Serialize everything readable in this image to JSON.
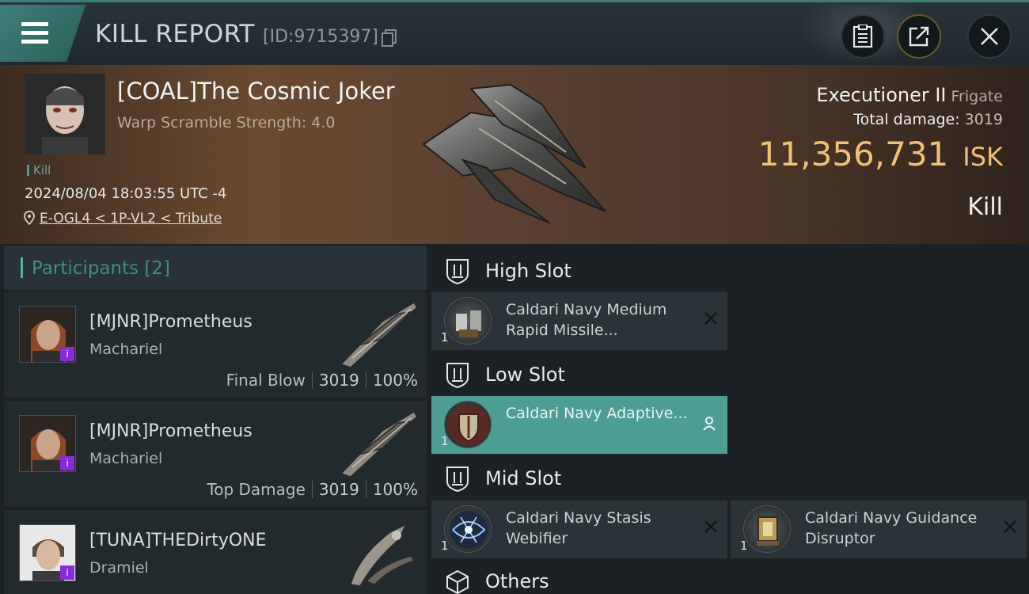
{
  "header": {
    "title": "KILL REPORT",
    "id_label": "[ID:9715397]",
    "icons": [
      "menu-icon",
      "copy-icon",
      "clipboard-icon",
      "share-icon",
      "close-icon"
    ]
  },
  "victim": {
    "name": "[COAL]The Cosmic Joker",
    "subtitle": "Warp Scramble Strength: 4.0",
    "tag": "Kill",
    "datetime": "2024/08/04 18:03:55 UTC -4",
    "location": "E-OGL4 < 1P-VL2 < Tribute",
    "ship_name": "Executioner II",
    "ship_class": "Frigate",
    "total_damage_label": "Total damage:",
    "total_damage": "3019",
    "isk_value": "11,356,731",
    "isk_unit": "ISK",
    "result": "Kill"
  },
  "participants": {
    "header": "Participants [2]",
    "rows": [
      {
        "name": "[MJNR]Prometheus",
        "ship": "Machariel",
        "role": "Final Blow",
        "damage": "3019",
        "percent": "100%",
        "badge": "i"
      },
      {
        "name": "[MJNR]Prometheus",
        "ship": "Machariel",
        "role": "Top Damage",
        "damage": "3019",
        "percent": "100%",
        "badge": "i"
      },
      {
        "name": "[TUNA]THEDirtyONE",
        "ship": "Dramiel",
        "role": "",
        "damage": "",
        "percent": "",
        "badge": "i"
      }
    ]
  },
  "fitting": {
    "high_slot": {
      "label": "High Slot",
      "modules": [
        {
          "name": "Caldari Navy Medium Rapid Missile...",
          "qty": "1"
        }
      ]
    },
    "low_slot": {
      "label": "Low Slot",
      "modules": [
        {
          "name": "Caldari Navy Adaptive...",
          "qty": "1"
        }
      ]
    },
    "mid_slot": {
      "label": "Mid Slot",
      "modules": [
        {
          "name": "Caldari Navy Stasis Webifier",
          "qty": "1"
        },
        {
          "name": "Caldari Navy Guidance Disruptor",
          "qty": "1"
        }
      ]
    },
    "others": {
      "label": "Others"
    }
  },
  "colors": {
    "accent": "#4e9d94",
    "isk": "#f0c078",
    "badge": "#8a2bd9"
  }
}
